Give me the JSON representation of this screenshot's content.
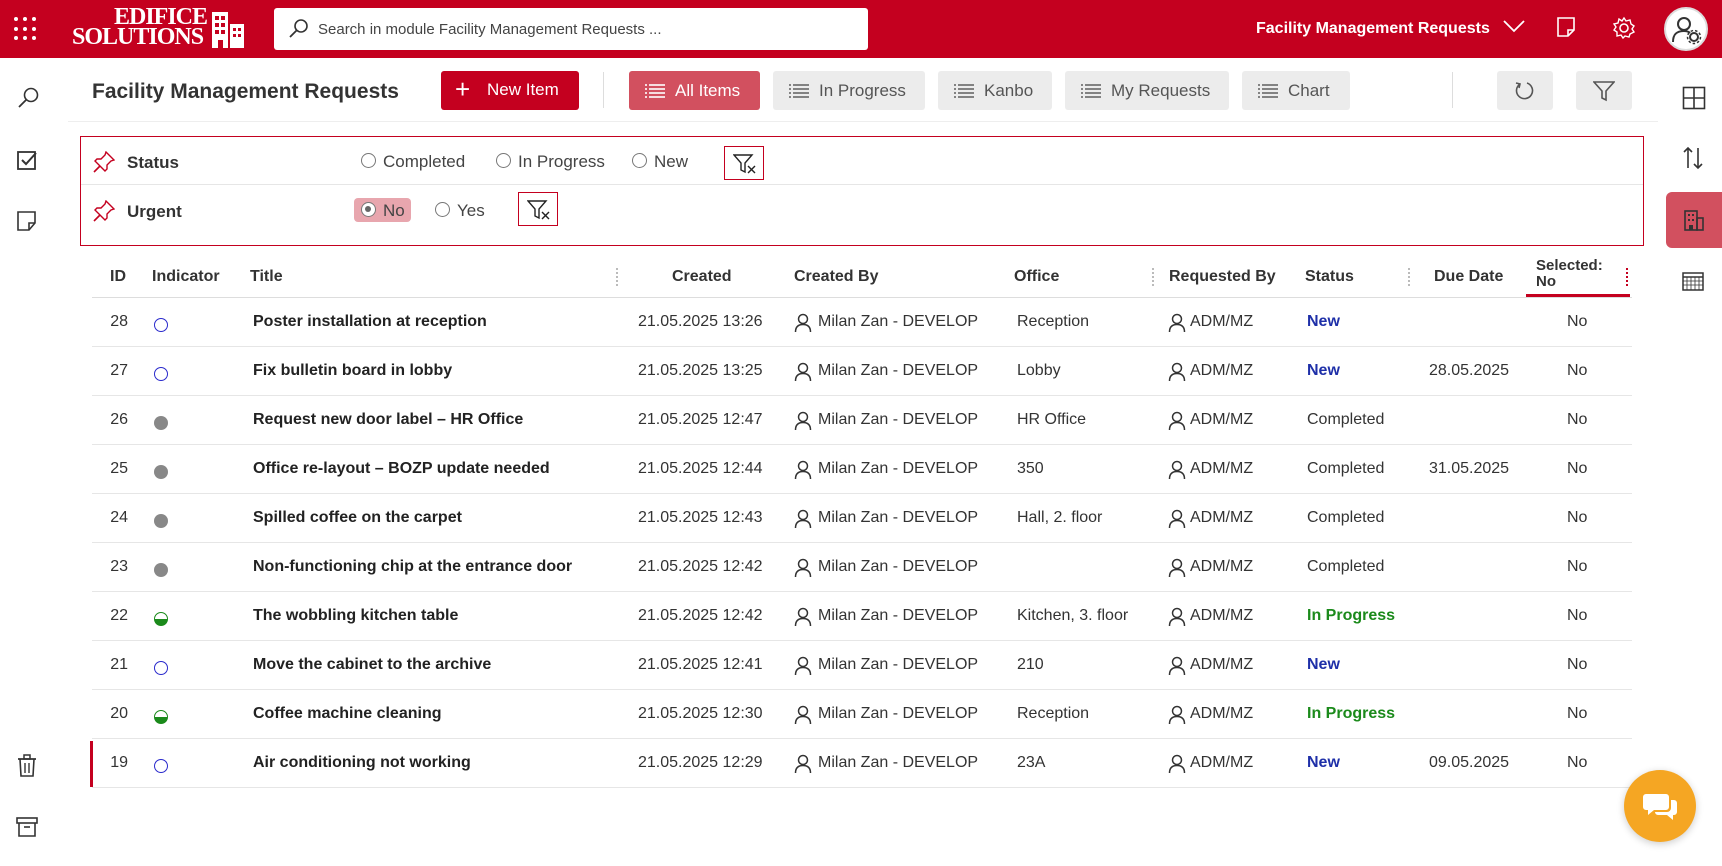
{
  "header": {
    "logo_line1": "EDIFICE",
    "logo_line2": "SOLUTIONS",
    "search_placeholder": "Search in module Facility Management Requests ...",
    "module_title": "Facility Management Requests"
  },
  "toolbar": {
    "page_title": "Facility Management Requests",
    "new_item_label": "New Item",
    "views": [
      {
        "label": "All Items",
        "active": true
      },
      {
        "label": "In Progress",
        "active": false
      },
      {
        "label": "Kanbo",
        "active": false
      },
      {
        "label": "My Requests",
        "active": false
      },
      {
        "label": "Chart",
        "active": false
      }
    ]
  },
  "filters": {
    "status": {
      "label": "Status",
      "options": [
        "Completed",
        "In Progress",
        "New"
      ]
    },
    "urgent": {
      "label": "Urgent",
      "options": [
        "No",
        "Yes"
      ],
      "selected": "No"
    }
  },
  "table": {
    "columns": {
      "id": "ID",
      "indicator": "Indicator",
      "title": "Title",
      "created": "Created",
      "created_by": "Created By",
      "office": "Office",
      "requested_by": "Requested By",
      "status": "Status",
      "due_date": "Due Date",
      "selected_line1": "Selected:",
      "selected_line2": "No"
    },
    "rows": [
      {
        "id": "28",
        "indicator": "new",
        "title": "Poster installation at reception",
        "created": "21.05.2025 13:26",
        "created_by": "Milan Zan - DEVELOP",
        "office": "Reception",
        "requested_by": "ADM/MZ",
        "status": "New",
        "due_date": "",
        "selected": "No"
      },
      {
        "id": "27",
        "indicator": "new",
        "title": "Fix bulletin board in lobby",
        "created": "21.05.2025 13:25",
        "created_by": "Milan Zan - DEVELOP",
        "office": "Lobby",
        "requested_by": "ADM/MZ",
        "status": "New",
        "due_date": "28.05.2025",
        "selected": "No"
      },
      {
        "id": "26",
        "indicator": "done",
        "title": "Request new door label – HR Office",
        "created": "21.05.2025 12:47",
        "created_by": "Milan Zan - DEVELOP",
        "office": "HR Office",
        "requested_by": "ADM/MZ",
        "status": "Completed",
        "due_date": "",
        "selected": "No"
      },
      {
        "id": "25",
        "indicator": "done",
        "title": "Office re-layout – BOZP update needed",
        "created": "21.05.2025 12:44",
        "created_by": "Milan Zan - DEVELOP",
        "office": "350",
        "requested_by": "ADM/MZ",
        "status": "Completed",
        "due_date": "31.05.2025",
        "selected": "No"
      },
      {
        "id": "24",
        "indicator": "done",
        "title": "Spilled coffee on the carpet",
        "created": "21.05.2025 12:43",
        "created_by": "Milan Zan - DEVELOP",
        "office": "Hall, 2. floor",
        "requested_by": "ADM/MZ",
        "status": "Completed",
        "due_date": "",
        "selected": "No"
      },
      {
        "id": "23",
        "indicator": "done",
        "title": "Non-functioning chip at the entrance door",
        "created": "21.05.2025 12:42",
        "created_by": "Milan Zan - DEVELOP",
        "office": "",
        "requested_by": "ADM/MZ",
        "status": "Completed",
        "due_date": "",
        "selected": "No"
      },
      {
        "id": "22",
        "indicator": "prog",
        "title": "The wobbling kitchen table",
        "created": "21.05.2025 12:42",
        "created_by": "Milan Zan - DEVELOP",
        "office": "Kitchen, 3. floor",
        "requested_by": "ADM/MZ",
        "status": "In Progress",
        "due_date": "",
        "selected": "No"
      },
      {
        "id": "21",
        "indicator": "new",
        "title": "Move the cabinet to the archive",
        "created": "21.05.2025 12:41",
        "created_by": "Milan Zan - DEVELOP",
        "office": "210",
        "requested_by": "ADM/MZ",
        "status": "New",
        "due_date": "",
        "selected": "No"
      },
      {
        "id": "20",
        "indicator": "prog",
        "title": "Coffee machine cleaning",
        "created": "21.05.2025 12:30",
        "created_by": "Milan Zan - DEVELOP",
        "office": "Reception",
        "requested_by": "ADM/MZ",
        "status": "In Progress",
        "due_date": "",
        "selected": "No"
      },
      {
        "id": "19",
        "indicator": "new",
        "title": "Air conditioning not working",
        "created": "21.05.2025 12:29",
        "created_by": "Milan Zan - DEVELOP",
        "office": "23A",
        "requested_by": "ADM/MZ",
        "status": "New",
        "due_date": "09.05.2025",
        "selected": "No"
      }
    ]
  },
  "colors": {
    "brand": "#c4001f",
    "active_tab": "#d2505f",
    "status_new": "#1e2fa8",
    "status_in_progress": "#1b8a1b",
    "chat": "#f5a623"
  }
}
